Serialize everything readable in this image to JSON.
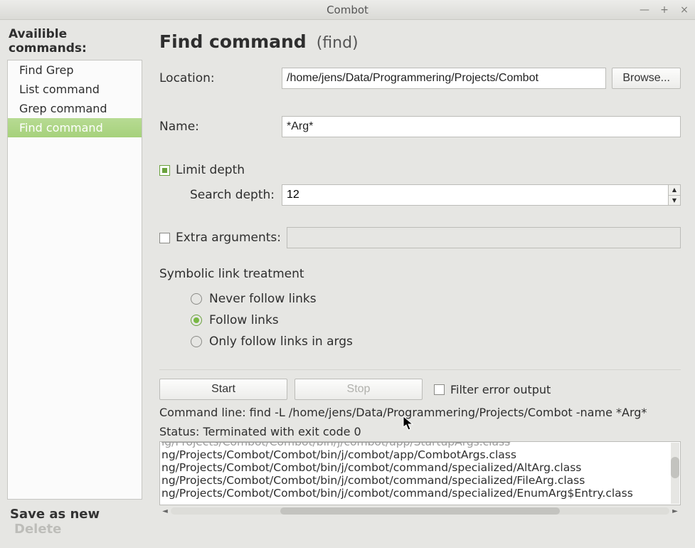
{
  "window": {
    "title": "Combot"
  },
  "sidebar": {
    "heading": "Availible commands:",
    "items": [
      {
        "label": "Find Grep"
      },
      {
        "label": "List command"
      },
      {
        "label": "Grep command"
      },
      {
        "label": "Find command",
        "selected": true
      }
    ],
    "save_label": "Save as new",
    "delete_label": "Delete"
  },
  "header": {
    "title": "Find command",
    "sub": "(find)"
  },
  "form": {
    "location_label": "Location:",
    "location_value": "/home/jens/Data/Programmering/Projects/Combot",
    "browse_label": "Browse...",
    "name_label": "Name:",
    "name_value": "*Arg*",
    "limit_depth_label": "Limit depth",
    "limit_depth_checked": true,
    "search_depth_label": "Search depth:",
    "search_depth_value": "12",
    "extra_args_label": "Extra arguments:",
    "extra_args_checked": false,
    "extra_args_value": "",
    "symlink_heading": "Symbolic link treatment",
    "symlink_options": [
      {
        "label": "Never follow links",
        "selected": false
      },
      {
        "label": "Follow links",
        "selected": true
      },
      {
        "label": "Only follow links in args",
        "selected": false
      }
    ]
  },
  "actions": {
    "start_label": "Start",
    "stop_label": "Stop",
    "filter_label": "Filter error output",
    "filter_checked": false
  },
  "results": {
    "commandline_label": "Command line: ",
    "commandline_value": "find -L /home/jens/Data/Programmering/Projects/Combot -name *Arg*",
    "status_label": "Status: ",
    "status_value": "Terminated with exit code 0",
    "lines": [
      "ig/Projects/Combot/Combot/bin/j/combot/app/StartupArgs.class",
      "ng/Projects/Combot/Combot/bin/j/combot/app/CombotArgs.class",
      "ng/Projects/Combot/Combot/bin/j/combot/command/specialized/AltArg.class",
      "ng/Projects/Combot/Combot/bin/j/combot/command/specialized/FileArg.class",
      "ng/Projects/Combot/Combot/bin/j/combot/command/specialized/EnumArg$Entry.class"
    ]
  }
}
